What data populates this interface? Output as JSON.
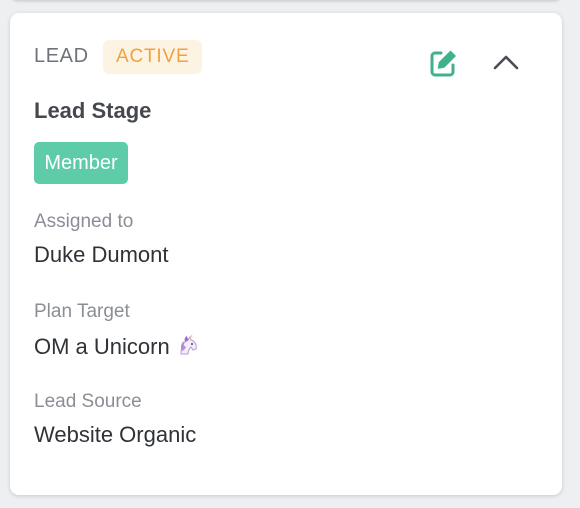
{
  "card": {
    "header_label": "LEAD",
    "status": "ACTIVE",
    "section_title": "Lead Stage",
    "stage": "Member",
    "icons": {
      "edit": "edit-icon",
      "collapse": "chevron-up-icon",
      "unicorn": "unicorn-emoji"
    },
    "fields": [
      {
        "label": "Assigned to",
        "value": "Duke Dumont"
      },
      {
        "label": "Plan Target",
        "value": "OM a Unicorn"
      },
      {
        "label": "Lead Source",
        "value": "Website Organic"
      }
    ]
  },
  "colors": {
    "status_text": "#f0a23c",
    "status_bg": "#fdf3e3",
    "stage_bg": "#5ecca9",
    "edit_icon": "#3fb28c"
  }
}
